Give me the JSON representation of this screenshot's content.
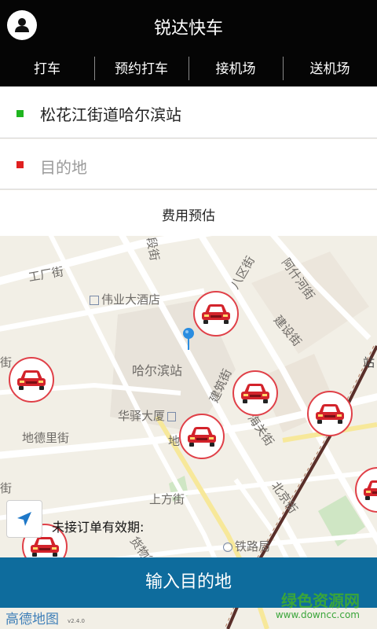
{
  "header": {
    "title": "锐达快车",
    "avatar_icon": "user-icon",
    "tabs": [
      {
        "label": "打车"
      },
      {
        "label": "预约打车"
      },
      {
        "label": "接机场"
      },
      {
        "label": "送机场"
      }
    ]
  },
  "route": {
    "origin": "松花江街道哈尔滨站",
    "destination_placeholder": "目的地",
    "fee_estimate": "费用预估"
  },
  "map": {
    "labels": {
      "gongchang": "工厂街",
      "duan": "段街",
      "bagu": "八区街",
      "ashihe": "阿什河街",
      "weiye": "伟业大酒店",
      "jianshe": "建设街",
      "hrb_station": "哈尔滨站",
      "jianzhu": "建筑街",
      "huayi": "华驿大厦",
      "haiguan": "海关街",
      "dide": "地德里街",
      "shangfang": "上方街",
      "beijing": "北京街",
      "tielu": "铁路局",
      "huowu": "货物街",
      "jie_left": "街",
      "jie_low": "街",
      "zhan": "站",
      "di": "地",
      "shangfang_low": "街"
    },
    "pin_icon": "location-pin-icon",
    "car_icon": "car-icon",
    "locate_icon": "locate-arrow-icon",
    "cars_count": 7
  },
  "order": {
    "validity_label": "未接订单有效期:"
  },
  "cta": {
    "label": "输入目的地"
  },
  "footer": {
    "map_provider": "高德地图",
    "version": "v2.4.0",
    "watermark_name": "绿色资源网",
    "watermark_url": "www.downcc.com"
  },
  "colors": {
    "header_bg": "#050505",
    "cta_bg": "#0e6c9d",
    "origin_dot": "#1fb51f",
    "dest_dot": "#e02020",
    "car_ring": "#e04048"
  }
}
